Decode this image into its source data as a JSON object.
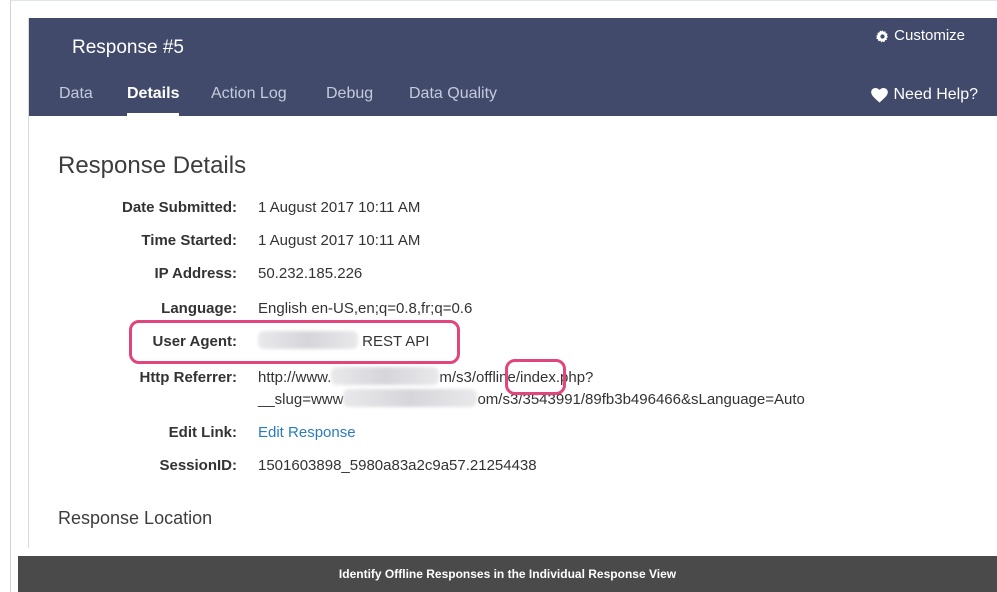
{
  "header": {
    "title": "Response #5",
    "customize_label": "Customize",
    "help_label": "Need Help?",
    "tabs": [
      {
        "label": "Data"
      },
      {
        "label": "Details"
      },
      {
        "label": "Action Log"
      },
      {
        "label": "Debug"
      },
      {
        "label": "Data Quality"
      }
    ],
    "active_tab": "Details"
  },
  "details": {
    "section_title": "Response Details",
    "date_submitted": {
      "label": "Date Submitted:",
      "value": "1 August 2017 10:11 AM"
    },
    "time_started": {
      "label": "Time Started:",
      "value": "1 August 2017 10:11 AM"
    },
    "ip_address": {
      "label": "IP Address:",
      "value": "50.232.185.226"
    },
    "language": {
      "label": "Language:",
      "value": "English en-US,en;q=0.8,fr;q=0.6"
    },
    "user_agent": {
      "label": "User Agent:",
      "value_tail": "REST API"
    },
    "http_referrer": {
      "label": "Http Referrer:",
      "line1_start": "http://www.",
      "line1_mid": "m/s3/",
      "line1_highlight": "offline",
      "line1_end": "/index.php?",
      "line2_start": "__slug=www",
      "line2_end": "om/s3/3543991/89fb3b496466&sLanguage=Auto"
    },
    "edit_link": {
      "label": "Edit Link:",
      "value": "Edit Response"
    },
    "session_id": {
      "label": "SessionID:",
      "value": "1501603898_5980a83a2c9a57.21254438"
    }
  },
  "location": {
    "title": "Response Location"
  },
  "caption": "Identify Offline Responses in the Individual Response View",
  "colors": {
    "header_bg": "#414a6b",
    "highlight": "#e0457b",
    "link": "#2a7bbf",
    "caption_bg": "#4a4a4a"
  }
}
